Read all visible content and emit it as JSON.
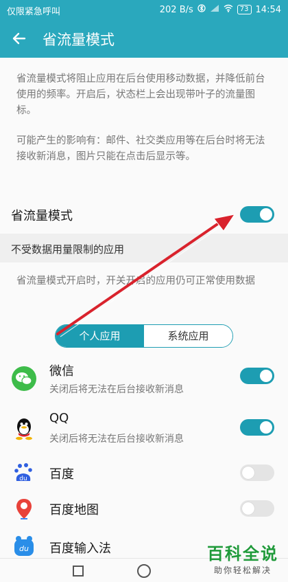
{
  "status_bar": {
    "carrier": "仅限紧急呼叫",
    "network_speed": "202 B/s",
    "battery": "73",
    "time": "14:54"
  },
  "app_bar": {
    "title": "省流量模式",
    "back_icon": "back-arrow-icon"
  },
  "description": {
    "p1": "省流量模式将阻止应用在后台使用移动数据，并降低前台使用的频率。开启后，状态栏上会出现带叶子的流量图标。",
    "p2": "可能产生的影响有：邮件、社交类应用等在后台时将无法接收新消息，图片只能在点击后显示等。"
  },
  "main_toggle": {
    "label": "省流量模式",
    "on": true
  },
  "section": {
    "title": "不受数据用量限制的应用",
    "note": "省流量模式开启时，开关开启的应用仍可正常使用数据"
  },
  "tabs": {
    "personal": "个人应用",
    "system": "系统应用",
    "active": "personal"
  },
  "apps": [
    {
      "name": "微信",
      "subtitle": "关闭后将无法在后台接收新消息",
      "icon": "wechat-icon",
      "enabled": true
    },
    {
      "name": "QQ",
      "subtitle": "关闭后将无法在后台接收新消息",
      "icon": "qq-icon",
      "enabled": true
    },
    {
      "name": "百度",
      "subtitle": "",
      "icon": "baidu-icon",
      "enabled": false
    },
    {
      "name": "百度地图",
      "subtitle": "",
      "icon": "baidu-map-icon",
      "enabled": false
    },
    {
      "name": "百度输入法",
      "subtitle": "",
      "icon": "baidu-input-icon",
      "enabled": false
    }
  ],
  "watermark": {
    "title": "百科全说",
    "subtitle": "助你轻松解决"
  },
  "colors": {
    "accent": "#1d9db2",
    "appbar": "#2aa8bd",
    "annotation_arrow": "#d9232d"
  }
}
